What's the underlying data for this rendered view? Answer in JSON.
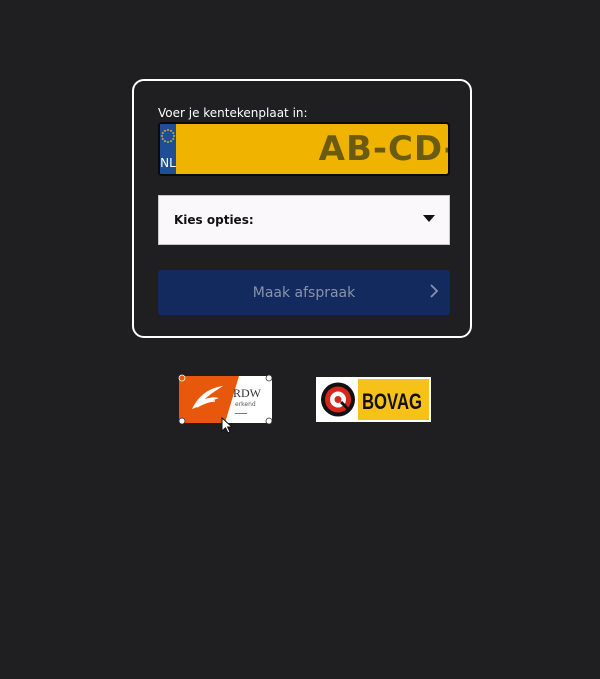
{
  "form": {
    "plate_label": "Voer je kentekenplaat in:",
    "plate_country": "NL",
    "plate_placeholder": "AB-CD-EF",
    "options_label": "Kies opties:",
    "submit_label": "Maak afspraak",
    "icons": {
      "eu_stars": "eu-stars-icon",
      "caret": "caret-down-icon",
      "chevron": "chevron-right-icon"
    }
  },
  "logos": {
    "rdw": {
      "name": "RDW",
      "sub": "erkend"
    },
    "bovag": {
      "name": "BOVAG"
    }
  },
  "colors": {
    "background": "#1f1e20",
    "plate_yellow": "#f0b400",
    "plate_blue": "#1f4e96",
    "button_navy": "#132a5e",
    "rdw_orange": "#e8580c",
    "bovag_yellow": "#f6c21a",
    "bovag_red": "#d7261e"
  }
}
